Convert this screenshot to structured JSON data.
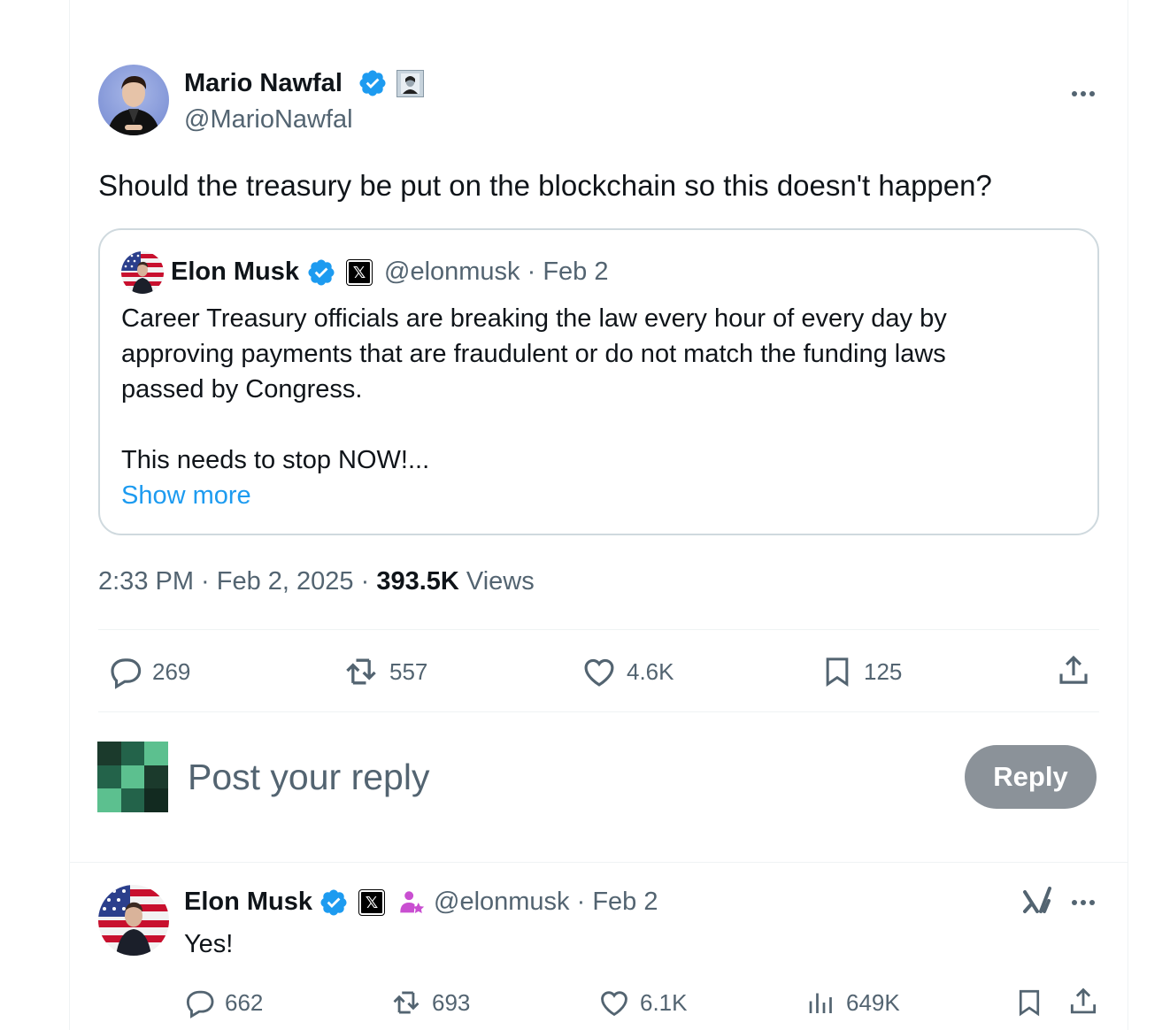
{
  "main_tweet": {
    "author_name": "Mario Nawfal",
    "author_handle": "@MarioNawfal",
    "text": "Should the treasury be put on the blockchain so this doesn't happen?",
    "timestamp": "2:33 PM · Feb 2, 2025 · ",
    "views_count": "393.5K",
    "views_label": " Views",
    "more_icon": "more-dots-icon"
  },
  "quoted_tweet": {
    "author_name": "Elon Musk",
    "author_handle": "@elonmusk",
    "date": " · Feb 2",
    "line1": "Career Treasury officials are breaking the law every hour of every day by",
    "line2": "approving payments that are fraudulent or do not match the funding laws",
    "line3": "passed by Congress.",
    "line4": "This needs to stop NOW!...",
    "show_more": "Show more"
  },
  "actions": {
    "replies": "269",
    "reposts": "557",
    "likes": "4.6K",
    "bookmarks": "125"
  },
  "compose": {
    "placeholder": "Post your reply",
    "reply_button": "Reply"
  },
  "reply_tweet": {
    "author_name": "Elon Musk",
    "author_handle": "@elonmusk",
    "date": " · Feb 2",
    "text": "Yes!",
    "replies": "662",
    "reposts": "693",
    "likes": "6.1K",
    "views": "649K"
  },
  "colors": {
    "accent": "#1d9bf0",
    "muted": "#536471",
    "verified": "#1d9bf0",
    "reply_button_disabled": "#8b9299"
  }
}
